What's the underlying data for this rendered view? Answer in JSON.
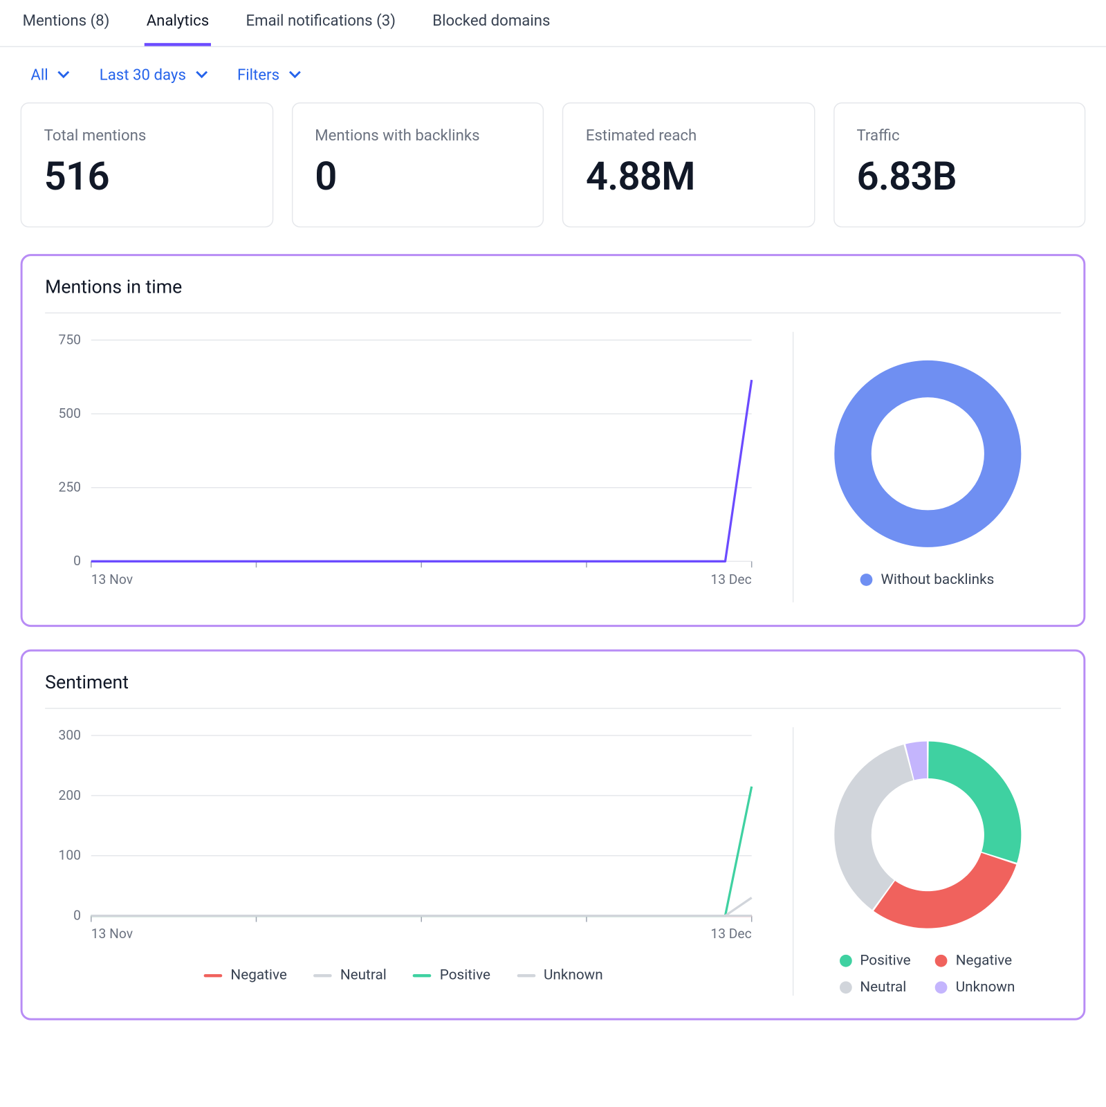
{
  "tabs": [
    {
      "label": "Mentions (8)",
      "active": false
    },
    {
      "label": "Analytics",
      "active": true
    },
    {
      "label": "Email notifications (3)",
      "active": false
    },
    {
      "label": "Blocked domains",
      "active": false
    }
  ],
  "filters": {
    "all": "All",
    "range": "Last 30 days",
    "filters": "Filters"
  },
  "kpis": {
    "total_mentions": {
      "label": "Total mentions",
      "value": "516"
    },
    "with_backlinks": {
      "label": "Mentions with backlinks",
      "value": "0"
    },
    "reach": {
      "label": "Estimated reach",
      "value": "4.88M"
    },
    "traffic": {
      "label": "Traffic",
      "value": "6.83B"
    }
  },
  "mentions_panel": {
    "title": "Mentions in time",
    "donut_legend": "Without backlinks"
  },
  "sentiment_panel": {
    "title": "Sentiment",
    "chart_legend": {
      "negative": "Negative",
      "neutral": "Neutral",
      "positive": "Positive",
      "unknown": "Unknown"
    },
    "donut_legend": {
      "positive": "Positive",
      "negative": "Negative",
      "neutral": "Neutral",
      "unknown": "Unknown"
    }
  },
  "colors": {
    "purple": "#6b4bff",
    "blue": "#6f8ff2",
    "red": "#f0625d",
    "grey": "#d1d5db",
    "teal": "#3fd1a1",
    "lilac": "#c4b5fd"
  },
  "chart_data": [
    {
      "id": "mentions_line",
      "type": "line",
      "title": "Mentions in time",
      "x_start": "13 Nov",
      "x_end": "13 Dec",
      "ylim": [
        0,
        750
      ],
      "yticks": [
        0,
        250,
        500,
        750
      ],
      "series": [
        {
          "name": "Mentions",
          "color": "#6b4bff",
          "x_rel": [
            0.0,
            0.25,
            0.5,
            0.75,
            0.96,
            1.0
          ],
          "values": [
            0,
            0,
            0,
            0,
            0,
            615
          ]
        }
      ]
    },
    {
      "id": "mentions_donut",
      "type": "pie",
      "title": "Backlink share",
      "series": [
        {
          "name": "Without backlinks",
          "value": 100,
          "color": "#6f8ff2"
        }
      ]
    },
    {
      "id": "sentiment_line",
      "type": "line",
      "title": "Sentiment",
      "x_start": "13 Nov",
      "x_end": "13 Dec",
      "ylim": [
        0,
        300
      ],
      "yticks": [
        0,
        100,
        200,
        300
      ],
      "series": [
        {
          "name": "Negative",
          "color": "#f0625d",
          "x_rel": [
            0.0,
            0.96,
            1.0
          ],
          "values": [
            0,
            0,
            0
          ]
        },
        {
          "name": "Neutral",
          "color": "#d1d5db",
          "x_rel": [
            0.0,
            0.96,
            1.0
          ],
          "values": [
            0,
            0,
            0
          ]
        },
        {
          "name": "Positive",
          "color": "#3fd1a1",
          "x_rel": [
            0.0,
            0.96,
            1.0
          ],
          "values": [
            0,
            0,
            215
          ]
        },
        {
          "name": "Unknown",
          "color": "#d1d5db",
          "x_rel": [
            0.0,
            0.96,
            1.0
          ],
          "values": [
            0,
            0,
            30
          ]
        }
      ]
    },
    {
      "id": "sentiment_donut",
      "type": "pie",
      "title": "Sentiment share",
      "series": [
        {
          "name": "Positive",
          "value": 30,
          "color": "#3fd1a1"
        },
        {
          "name": "Negative",
          "value": 30,
          "color": "#f0625d"
        },
        {
          "name": "Neutral",
          "value": 36,
          "color": "#d1d5db"
        },
        {
          "name": "Unknown",
          "value": 4,
          "color": "#c4b5fd"
        }
      ]
    }
  ]
}
